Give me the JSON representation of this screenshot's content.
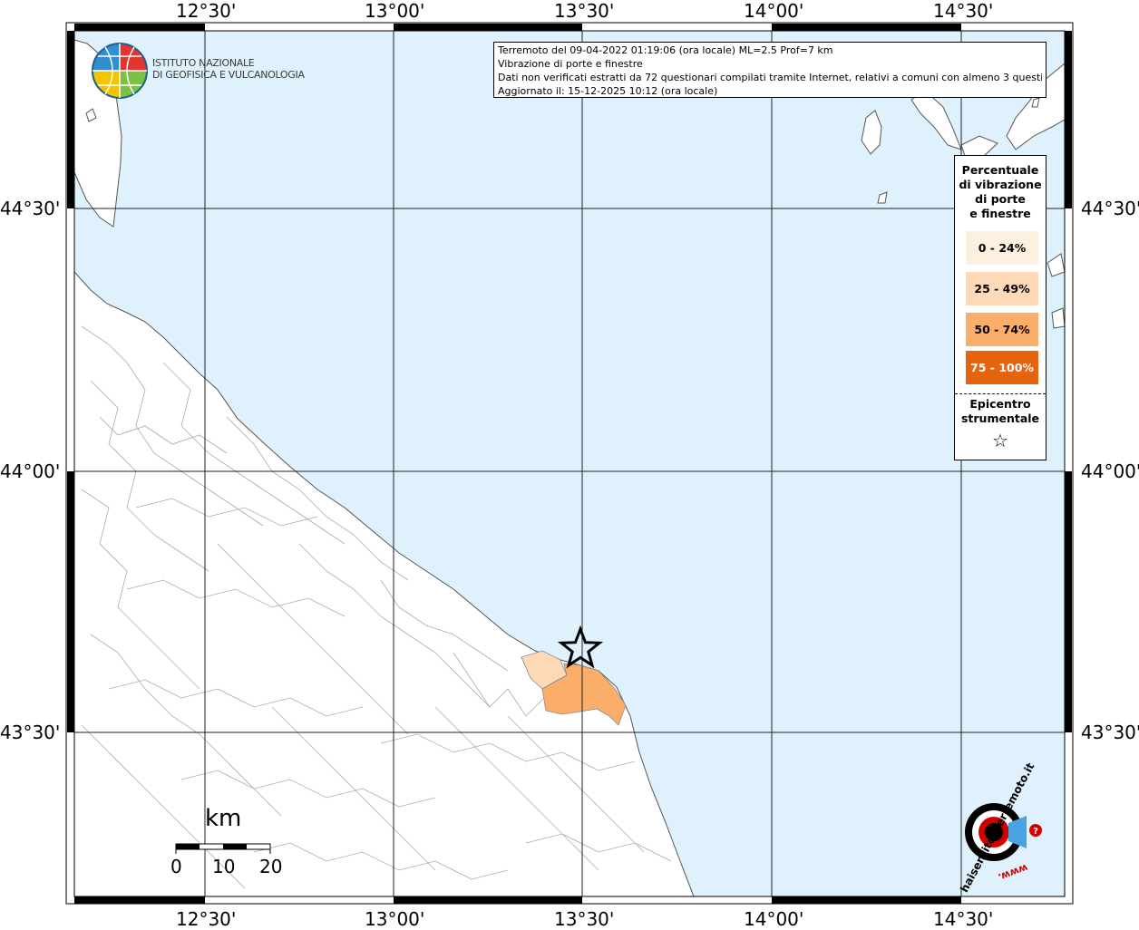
{
  "header": {
    "institute_line1": "ISTITUTO NAZIONALE",
    "institute_line2": "DI GEOFISICA E VULCANOLOGIA"
  },
  "info": {
    "line1": "Terremoto del 09-04-2022 01:19:06 (ora locale) ML=2.5 Prof=7 km",
    "line2": "Vibrazione di porte e finestre",
    "line3": "Dati non verificati estratti da 72 questionari compilati tramite Internet, relativi a comuni con almeno 3 questionari.",
    "line4": "Aggiornato il: 15-12-2025 10:12 (ora locale)"
  },
  "axes": {
    "x_labels": [
      "12°30'",
      "13°00'",
      "13°30'",
      "14°00'",
      "14°30'"
    ],
    "y_labels": [
      "44°30'",
      "44°00'",
      "43°30'"
    ]
  },
  "legend": {
    "title_lines": [
      "Percentuale",
      "di vibrazione",
      "di porte",
      "e finestre"
    ],
    "classes": [
      {
        "label": "0 - 24%",
        "color": "#fef0e0"
      },
      {
        "label": "25 - 49%",
        "color": "#fdd9b8"
      },
      {
        "label": "50 - 74%",
        "color": "#fbae6a"
      },
      {
        "label": "75 - 100%",
        "color": "#e7640e"
      }
    ],
    "epicenter_lines": [
      "Epicentro",
      "strumentale"
    ],
    "epicenter_symbol": "☆"
  },
  "scale_bar": {
    "unit": "km",
    "labels": [
      "0",
      "10",
      "20"
    ]
  },
  "watermark": {
    "text": "haisentitoilterremoto.it",
    "prefix": "www."
  },
  "colors": {
    "sea": "#dff1fd",
    "land": "#ffffff",
    "grid": "#222222",
    "border": "#9a9a9a"
  }
}
